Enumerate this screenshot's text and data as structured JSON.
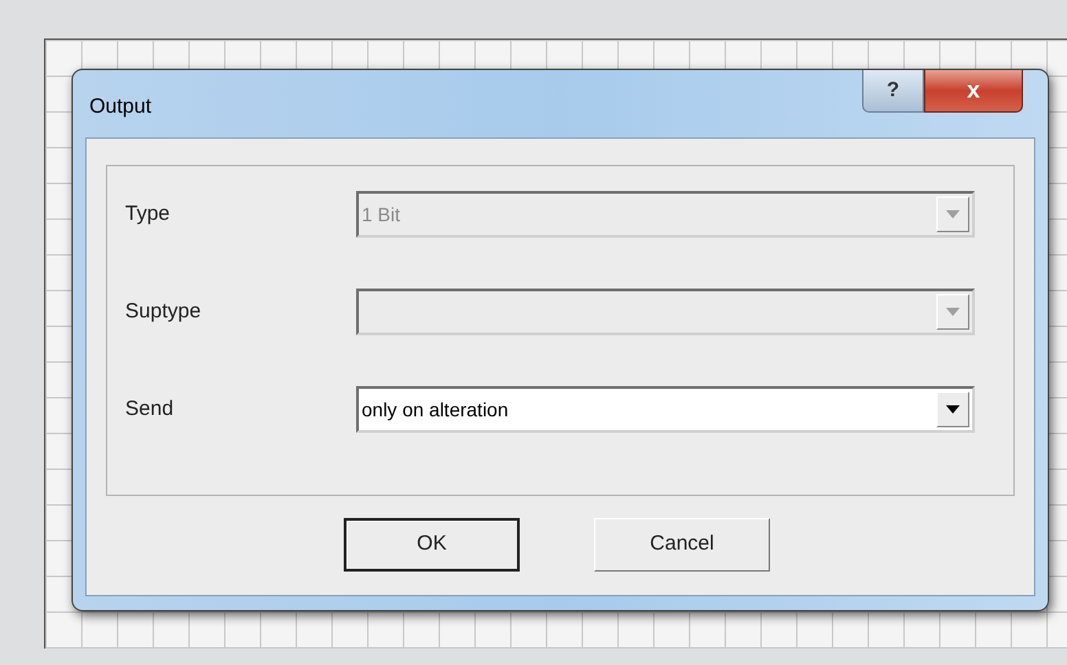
{
  "window": {
    "title": "Output"
  },
  "title_buttons": [
    {
      "kind": "help",
      "label": "?"
    },
    {
      "kind": "close",
      "label": "x"
    }
  ],
  "fields": [
    {
      "label": "Type",
      "value": "1 Bit",
      "disabled": true
    },
    {
      "label": "Suptype",
      "disabled": true
    },
    {
      "label": "Send",
      "value": "only on alteration",
      "disabled": false
    }
  ],
  "buttons": [
    {
      "label": "OK",
      "default": true
    },
    {
      "label": "Cancel",
      "default": false
    }
  ]
}
